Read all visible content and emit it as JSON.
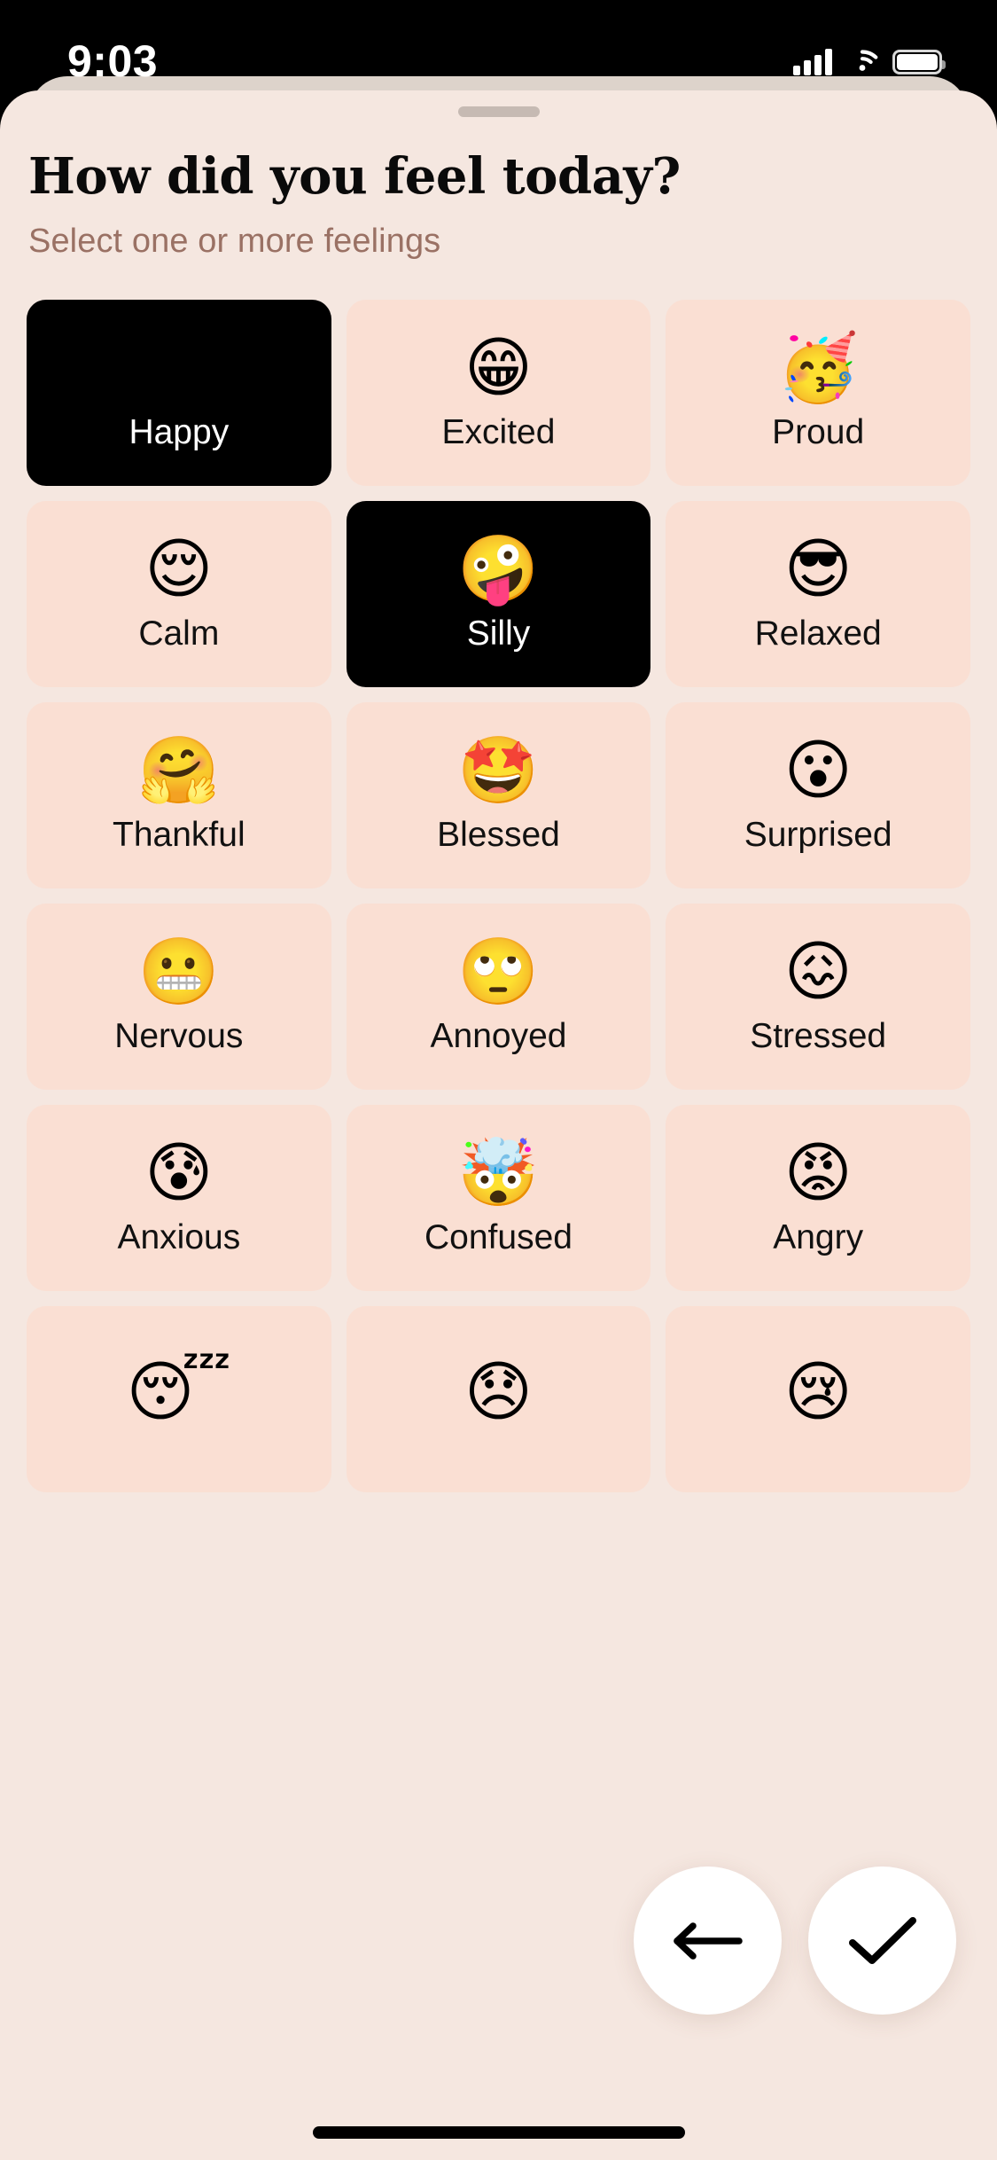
{
  "status_bar": {
    "time": "9:03",
    "signal_icon": "cellular-signal-icon",
    "wifi_icon": "wifi-icon",
    "battery_icon": "battery-full-icon"
  },
  "sheet": {
    "handle": "drag-handle",
    "title": "How did you feel today?",
    "subtitle": "Select one or more feelings"
  },
  "colors": {
    "sheet_background": "#f5e7e0",
    "card_background": "#fadfd3",
    "card_selected_background": "#000000",
    "subtitle_text": "#9a7164",
    "title_text": "#0a0a0a",
    "fab_background": "#ffffff",
    "status_bar_background": "#000000"
  },
  "moods": [
    {
      "label": "Happy",
      "emoji": "😊",
      "emoji_name": "smiling-face-with-smiling-eyes-emoji",
      "selected": true
    },
    {
      "label": "Excited",
      "emoji": "😁",
      "emoji_name": "beaming-face-with-smiling-eyes-emoji",
      "selected": false
    },
    {
      "label": "Proud",
      "emoji": "🥳",
      "emoji_name": "partying-face-emoji",
      "selected": false
    },
    {
      "label": "Calm",
      "emoji": "😌",
      "emoji_name": "relieved-face-emoji",
      "selected": false
    },
    {
      "label": "Silly",
      "emoji": "🤪",
      "emoji_name": "zany-face-emoji",
      "selected": true
    },
    {
      "label": "Relaxed",
      "emoji": "😎",
      "emoji_name": "smiling-face-with-sunglasses-emoji",
      "selected": false
    },
    {
      "label": "Thankful",
      "emoji": "🤗",
      "emoji_name": "hugging-face-emoji",
      "selected": false
    },
    {
      "label": "Blessed",
      "emoji": "🤩",
      "emoji_name": "star-struck-emoji",
      "selected": false
    },
    {
      "label": "Surprised",
      "emoji": "😮",
      "emoji_name": "face-with-open-mouth-emoji",
      "selected": false
    },
    {
      "label": "Nervous",
      "emoji": "😬",
      "emoji_name": "grimacing-face-emoji",
      "selected": false
    },
    {
      "label": "Annoyed",
      "emoji": "🙄",
      "emoji_name": "face-with-rolling-eyes-emoji",
      "selected": false
    },
    {
      "label": "Stressed",
      "emoji": "😖",
      "emoji_name": "confounded-face-emoji",
      "selected": false
    },
    {
      "label": "Anxious",
      "emoji": "😰",
      "emoji_name": "anxious-face-with-sweat-emoji",
      "selected": false
    },
    {
      "label": "Confused",
      "emoji": "🤯",
      "emoji_name": "exploding-head-emoji",
      "selected": false
    },
    {
      "label": "Angry",
      "emoji": "😡",
      "emoji_name": "enraged-face-emoji",
      "selected": false
    },
    {
      "label": "",
      "emoji": "😴",
      "emoji_name": "sleeping-face-emoji",
      "selected": false
    },
    {
      "label": "",
      "emoji": "😞",
      "emoji_name": "disappointed-face-emoji",
      "selected": false
    },
    {
      "label": "",
      "emoji": "😢",
      "emoji_name": "crying-face-emoji",
      "selected": false
    }
  ],
  "actions": {
    "back": {
      "icon": "arrow-left-icon",
      "label": "Back"
    },
    "confirm": {
      "icon": "checkmark-icon",
      "label": "Confirm"
    }
  },
  "home_indicator": "home-indicator"
}
